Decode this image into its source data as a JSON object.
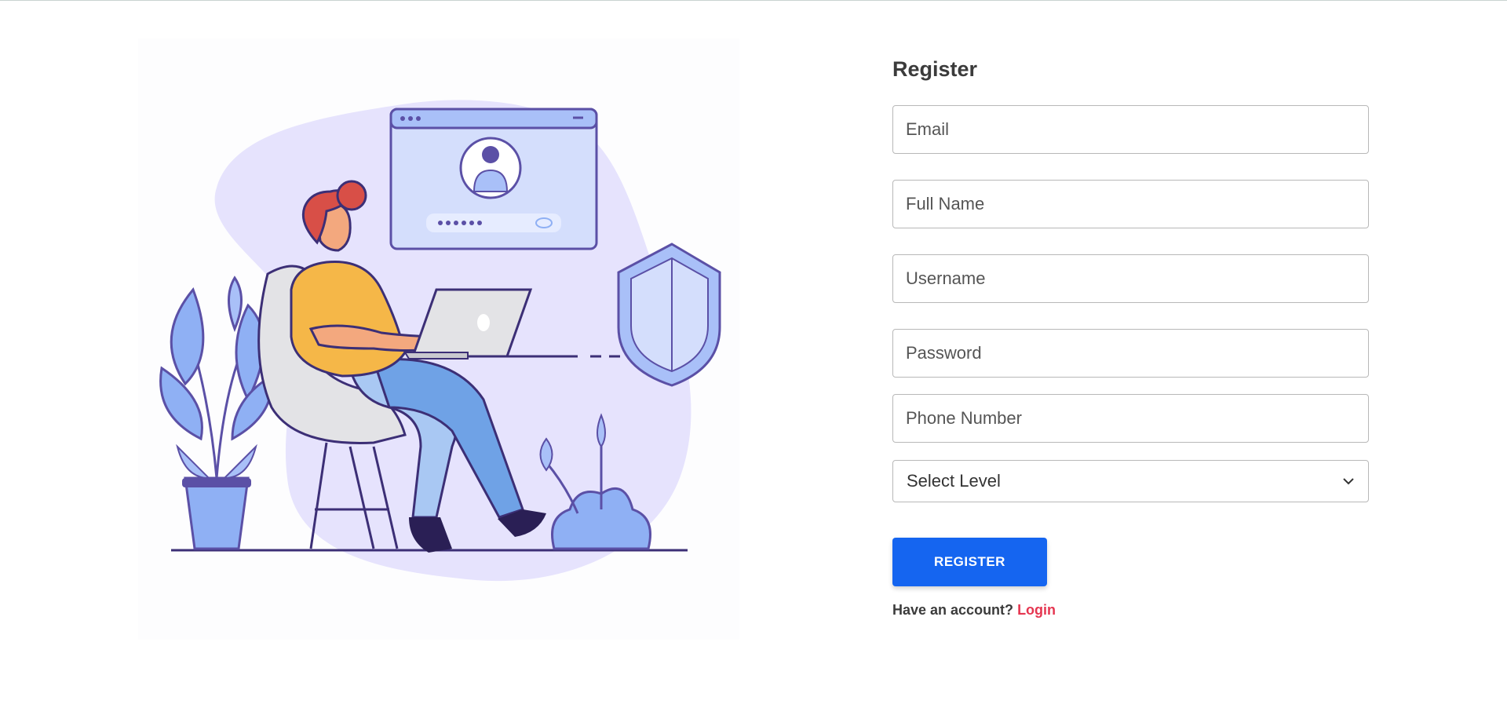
{
  "illustration": {
    "icon": "person-at-laptop-login-illustration",
    "colors": {
      "blob": "#e6e3fd",
      "outline": "#3c2f76",
      "hair": "#d84f47",
      "shirt": "#f5b748",
      "skin": "#f3a87e",
      "jeans": "#6fa2e6",
      "leaf": "#8fb0f4",
      "shield": "#a9c0f8"
    }
  },
  "form": {
    "title": "Register",
    "fields": [
      {
        "name": "email",
        "placeholder": "Email"
      },
      {
        "name": "full-name",
        "placeholder": "Full Name"
      },
      {
        "name": "username",
        "placeholder": "Username"
      },
      {
        "name": "password",
        "placeholder": "Password"
      },
      {
        "name": "phone-number",
        "placeholder": "Phone Number"
      }
    ],
    "level_select": {
      "selected": "Select Level",
      "icon": "chevron-down-icon"
    },
    "register_label": "REGISTER",
    "have_account_text": "Have an account?",
    "login_label": "Login"
  },
  "colors": {
    "primary": "#1565f0",
    "link": "#e53550",
    "text": "#3b3b3b",
    "border": "#b8b8b8"
  }
}
